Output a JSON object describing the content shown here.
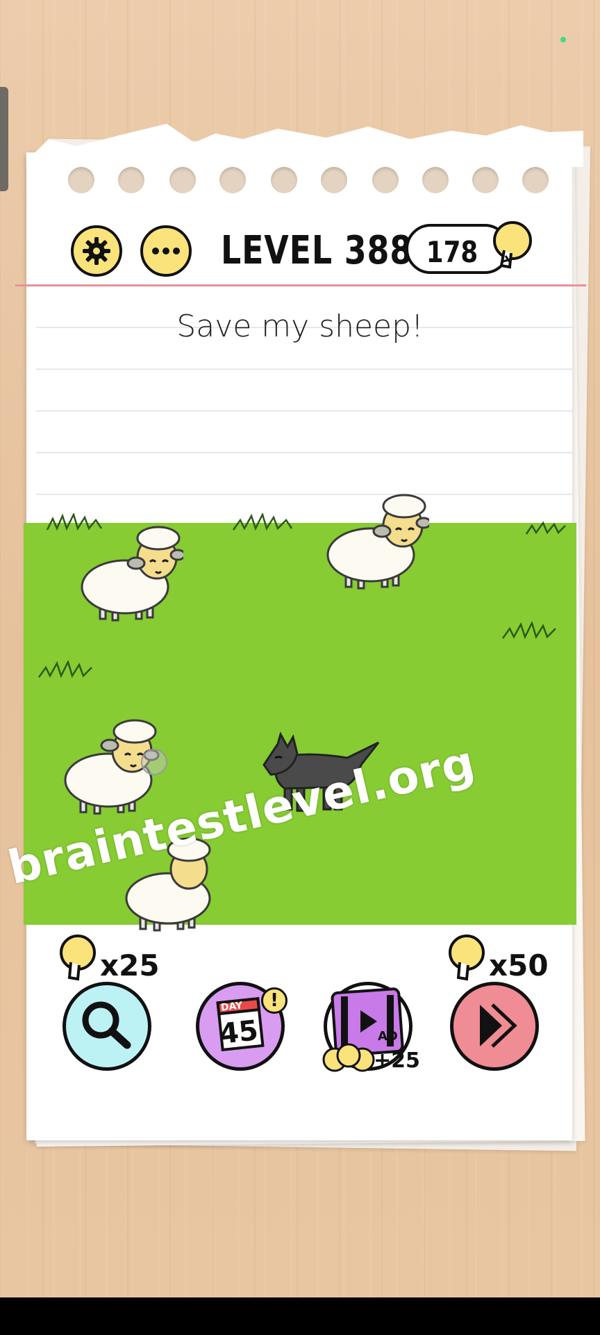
{
  "header": {
    "level_title": "LEVEL 388",
    "coins": "178",
    "settings_icon": "gear-icon",
    "more_icon": "more-icon"
  },
  "prompt": "Save my sheep!",
  "scene": {
    "sheep_count": 4,
    "wolf_count": 1,
    "ground_color": "#86cc32"
  },
  "tools": {
    "hint_cost": "x25",
    "daily_day": "45",
    "daily_label": "DAY",
    "daily_badge": "!",
    "ad_label": "AD",
    "ad_reward": "+25",
    "skip_cost": "x50"
  },
  "watermark": "braintestlevel.org",
  "colors": {
    "yellow": "#f9e37a",
    "hint_bg": "#bdf2f5",
    "daily_bg": "#d89cf0",
    "ad_bg": "#c77ae8",
    "skip_bg": "#f08c94"
  }
}
